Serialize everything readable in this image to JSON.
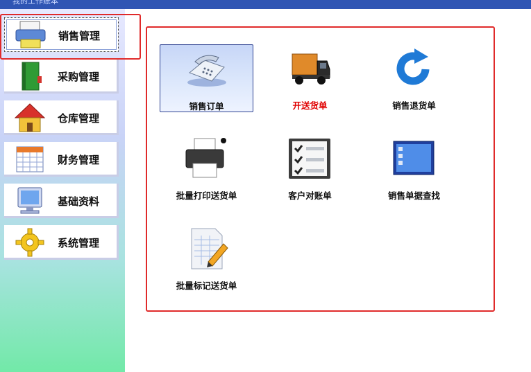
{
  "window": {
    "title": "我的工作账本"
  },
  "sidebar": {
    "items": [
      {
        "label": "销售管理"
      },
      {
        "label": "采购管理"
      },
      {
        "label": "仓库管理"
      },
      {
        "label": "财务管理"
      },
      {
        "label": "基础资料"
      },
      {
        "label": "系统管理"
      }
    ],
    "selected_index": 0
  },
  "main": {
    "tiles": [
      {
        "label": "销售订单"
      },
      {
        "label": "开送货单"
      },
      {
        "label": "销售退货单"
      },
      {
        "label": "批量打印送货单"
      },
      {
        "label": "客户对账单"
      },
      {
        "label": "销售单据查找"
      },
      {
        "label": "批量标记送货单"
      }
    ],
    "active_index": 0
  },
  "colors": {
    "titlebar": "#2f55b4",
    "highlight_border": "#e02a2a",
    "highlighted_label": "#e00000"
  }
}
